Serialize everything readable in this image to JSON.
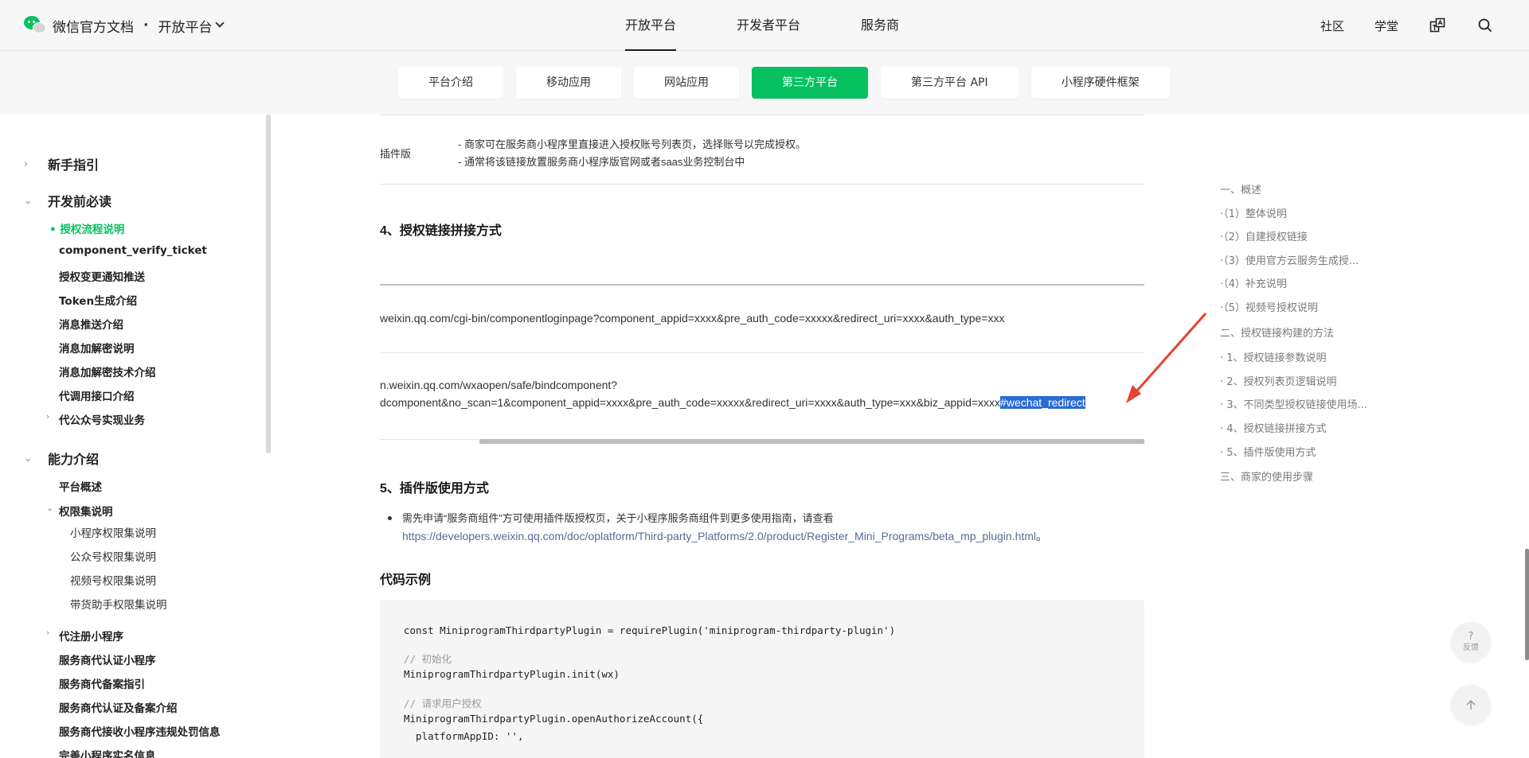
{
  "header": {
    "brand_title": "微信官方文档",
    "brand_separator": "·",
    "platform_label": "开放平台",
    "nav": [
      "开放平台",
      "开发者平台",
      "服务商"
    ],
    "links": [
      "社区",
      "学堂"
    ]
  },
  "subtabs": [
    "平台介绍",
    "移动应用",
    "网站应用",
    "第三方平台",
    "第三方平台 API",
    "小程序硬件框架"
  ],
  "sidebar": {
    "sections": [
      "新手指引",
      "开发前必读",
      "能力介绍"
    ],
    "dev_items": [
      "• 授权流程说明",
      "component_verify_ticket",
      "授权变更通知推送",
      "Token生成介绍",
      "消息推送介绍",
      "消息加解密说明",
      "消息加解密技术介绍",
      "代调用接口介绍",
      "代公众号实现业务"
    ],
    "ability_items": [
      "平台概述",
      "权限集说明",
      "小程序权限集说明",
      "公众号权限集说明",
      "视频号权限集说明",
      "带货助手权限集说明",
      "代注册小程序",
      "服务商代认证小程序",
      "服务商代备案指引",
      "服务商代认证及备案介绍",
      "服务商代接收小程序违规处罚信息",
      "完善小程序实名信息"
    ]
  },
  "content": {
    "plugin_label": "插件版",
    "plugin_line1": "- 商家可在服务商小程序里直接进入授权账号列表页，选择账号以完成授权。",
    "plugin_line2": "- 通常将该链接放置服务商小程序版官网或者saas业务控制台中",
    "heading4": "4、授权链接拼接方式",
    "url1": "weixin.qq.com/cgi-bin/componentloginpage?component_appid=xxxx&pre_auth_code=xxxxx&redirect_uri=xxxx&auth_type=xxx",
    "url2_line1": "n.weixin.qq.com/wxaopen/safe/bindcomponent?",
    "url2_line2": "dcomponent&no_scan=1&component_appid=xxxx&pre_auth_code=xxxxx&redirect_uri=xxxx&auth_type=xxx&biz_appid=xxxx",
    "url2_selected": "#wechat_redirect",
    "heading5": "5、插件版使用方式",
    "bullet_text": "需先申请“服务商组件”方可使用插件版授权页，关于小程序服务商组件到更多使用指南，请查看",
    "bullet_link": "https://developers.weixin.qq.com/doc/oplatform/Third-party_Platforms/2.0/product/Register_Mini_Programs/beta_mp_plugin.html",
    "bullet_end": "。",
    "code_heading": "代码示例",
    "code_lines": [
      "const MiniprogramThirdpartyPlugin = requirePlugin('miniprogram-thirdparty-plugin')",
      "// 初始化",
      "MiniprogramThirdpartyPlugin.init(wx)",
      "// 请求用户授权",
      "MiniprogramThirdpartyPlugin.openAuthorizeAccount({",
      "  platformAppID: '',"
    ]
  },
  "toc": [
    "一、概述",
    "·（1）整体说明",
    "·（2）自建授权链接",
    "·（3）使用官方云服务生成授...",
    "·（4）补充说明",
    "·（5）视频号授权说明",
    "二、授权链接构建的方法",
    "· 1、授权链接参数说明",
    "· 2、授权列表页逻辑说明",
    "· 3、不同类型授权链接使用场...",
    "· 4、授权链接拼接方式",
    "· 5、插件版使用方式",
    "三、商家的使用步骤"
  ],
  "float": {
    "help_symbol": "?",
    "feedback_label": "反馈"
  },
  "colors": {
    "accent": "#07c160",
    "link": "#576b95",
    "selection": "#2a6bd6",
    "annotation_arrow": "#e8412f"
  }
}
